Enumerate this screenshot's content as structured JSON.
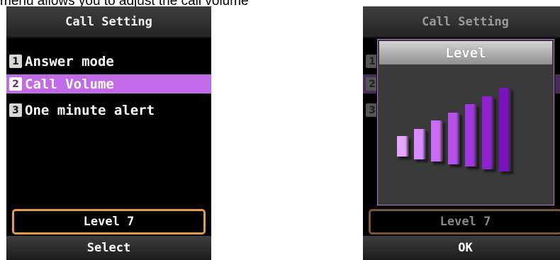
{
  "caption": "menu allows you to adjust the call volume",
  "screen1": {
    "title": "Call Setting",
    "menu": [
      {
        "number": "1",
        "label": "Answer mode"
      },
      {
        "number": "2",
        "label": "Call Volume",
        "selected": true
      },
      {
        "number": "3",
        "label": "One minute alert"
      }
    ],
    "level_text": "Level 7",
    "softkey": "Select"
  },
  "screen2": {
    "title": "Call Setting",
    "menu": [
      {
        "number": "1",
        "label": ""
      },
      {
        "number": "2",
        "label": "",
        "selected": true
      },
      {
        "number": "3",
        "label": ""
      }
    ],
    "level_text": "Level 7",
    "softkey": "OK",
    "popup": {
      "title": "Level",
      "level": 7,
      "max_level": 7
    }
  },
  "colors": {
    "highlight": "#c26be8",
    "level_border": "#e59a45",
    "bar_light": "#e6a6ff",
    "bar_dark": "#7a12bf"
  }
}
